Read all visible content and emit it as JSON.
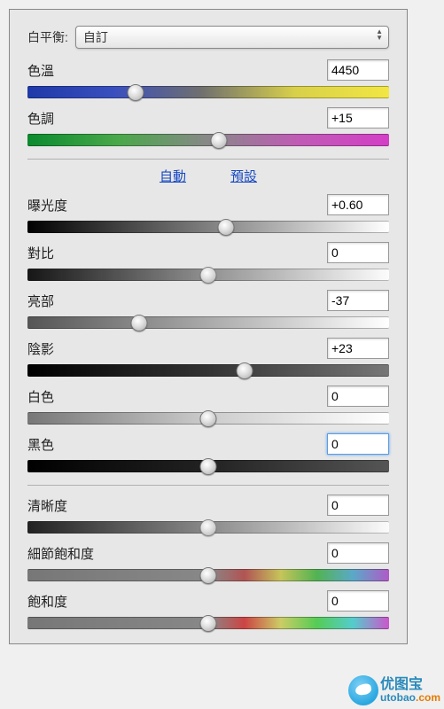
{
  "whiteBalance": {
    "label": "白平衡:",
    "value": "自訂"
  },
  "sliders": {
    "temperature": {
      "label": "色溫",
      "value": "4450",
      "pos": 30,
      "track": "t-temp"
    },
    "tint": {
      "label": "色調",
      "value": "+15",
      "pos": 53,
      "track": "t-tint"
    }
  },
  "links": {
    "auto": "自動",
    "default": "預設"
  },
  "basic": {
    "exposure": {
      "label": "曝光度",
      "value": "+0.60",
      "pos": 55,
      "track": "t-exp"
    },
    "contrast": {
      "label": "對比",
      "value": "0",
      "pos": 50,
      "track": "t-gray-mid"
    },
    "highlights": {
      "label": "亮部",
      "value": "-37",
      "pos": 31,
      "track": "t-high"
    },
    "shadows": {
      "label": "陰影",
      "value": "+23",
      "pos": 60,
      "track": "t-shad"
    },
    "whites": {
      "label": "白色",
      "value": "0",
      "pos": 50,
      "track": "t-white"
    },
    "blacks": {
      "label": "黑色",
      "value": "0",
      "pos": 50,
      "track": "t-black",
      "focused": true
    }
  },
  "presence": {
    "clarity": {
      "label": "清晰度",
      "value": "0",
      "pos": 50,
      "track": "t-clar"
    },
    "vibrance": {
      "label": "細節飽和度",
      "value": "0",
      "pos": 50,
      "track": "t-vib"
    },
    "saturation": {
      "label": "飽和度",
      "value": "0",
      "pos": 50,
      "track": "t-sat"
    }
  },
  "watermark": {
    "zh": "优图宝",
    "url_a": "utobao",
    "url_b": ".com"
  }
}
